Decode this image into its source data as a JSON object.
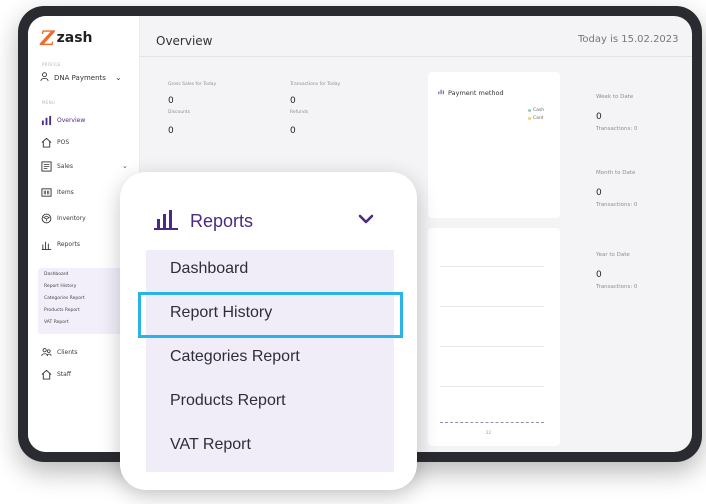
{
  "app": {
    "logo_text": "zash"
  },
  "sidebar": {
    "section_profile": "PROFILE",
    "account": "DNA Payments",
    "section_menu": "MENU",
    "items": [
      {
        "label": "Overview"
      },
      {
        "label": "POS"
      },
      {
        "label": "Sales"
      },
      {
        "label": "Items"
      },
      {
        "label": "Inventory"
      },
      {
        "label": "Reports"
      },
      {
        "label": "Clients"
      },
      {
        "label": "Staff"
      }
    ],
    "report_subitems": [
      "Dashboard",
      "Report History",
      "Categories Report",
      "Products Report",
      "VAT Report"
    ]
  },
  "header": {
    "title": "Overview",
    "date": "Today is 15.02.2023"
  },
  "stats": {
    "gross_sales_label": "Gross Sales for Today",
    "gross_sales_value": "0",
    "transactions_label": "Transactions for Today",
    "transactions_value": "0",
    "discounts_label": "Discounts",
    "discounts_value": "0",
    "refunds_label": "Refunds",
    "refunds_value": "0"
  },
  "payment_method": {
    "title": "Payment method",
    "legend": [
      "Cash",
      "Card"
    ],
    "tick_label": "22"
  },
  "periods": [
    {
      "label": "Week to Date",
      "value": "0",
      "sub": "Transactions: 0"
    },
    {
      "label": "Month to Date",
      "value": "0",
      "sub": "Transactions: 0"
    },
    {
      "label": "Year to Date",
      "value": "0",
      "sub": "Transactions: 0"
    }
  ],
  "popup": {
    "header": "Reports",
    "items": [
      "Dashboard",
      "Report History",
      "Categories Report",
      "Products Report",
      "VAT Report"
    ],
    "highlighted": "Report History"
  },
  "colors": {
    "accent": "#4b2a82",
    "highlight": "#2ab3e6",
    "logo": "#f06a2a",
    "cash": "#8fd3b0",
    "card": "#f5d36a"
  }
}
